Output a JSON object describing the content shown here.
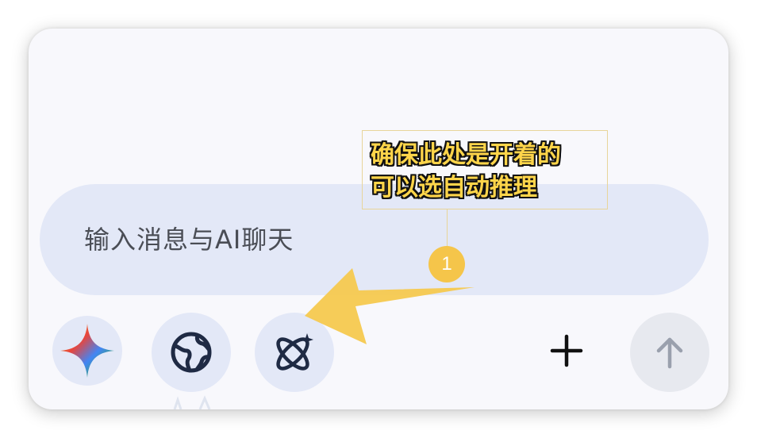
{
  "composer": {
    "placeholder": "输入消息与AI聊天"
  },
  "toolbar": {
    "model_icon": "sparkle-icon",
    "web_search_icon": "globe-icon",
    "reasoning_icon": "atom-icon",
    "attach_icon": "plus-icon",
    "send_icon": "arrow-up-icon"
  },
  "annotation": {
    "line1": "确保此处是开着的",
    "line2": "可以选自动推理",
    "badge": "1",
    "color": "#f5c54a"
  },
  "colors": {
    "pill": "#e3e8f7",
    "card": "#f8f8fc",
    "icon_dark": "#1f2a44"
  }
}
